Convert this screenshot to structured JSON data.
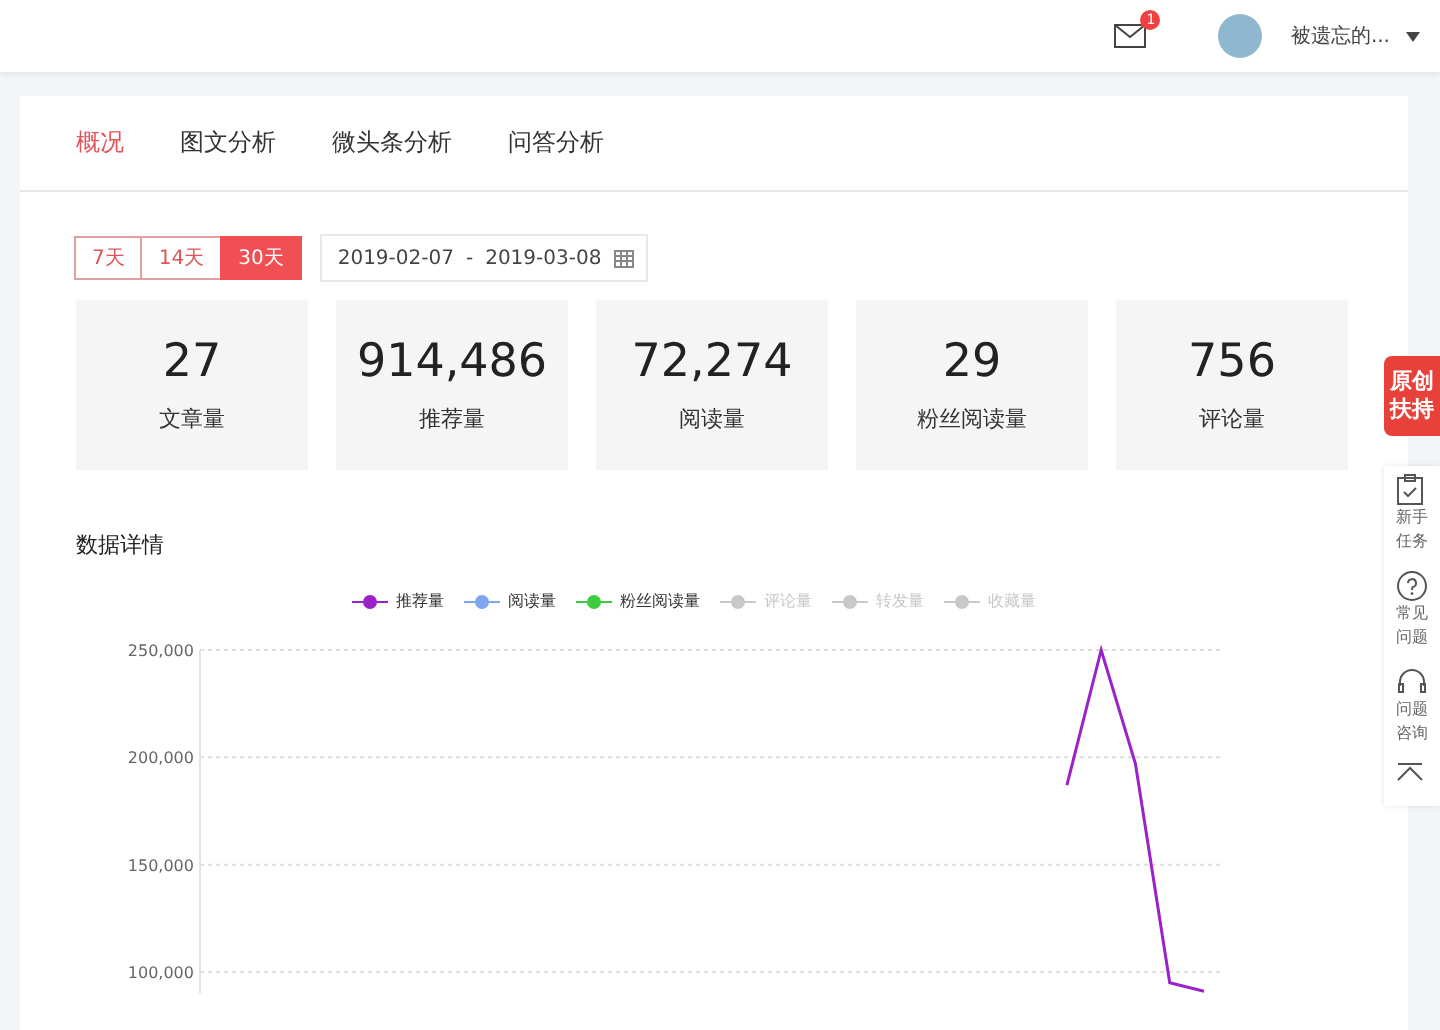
{
  "header": {
    "mail_badge": "1",
    "username": "被遗忘的..."
  },
  "tabs": [
    {
      "label": "概况",
      "selected": true
    },
    {
      "label": "图文分析",
      "selected": false
    },
    {
      "label": "微头条分析",
      "selected": false
    },
    {
      "label": "问答分析",
      "selected": false
    }
  ],
  "ranges": [
    {
      "label": "7天",
      "selected": false
    },
    {
      "label": "14天",
      "selected": false
    },
    {
      "label": "30天",
      "selected": true
    }
  ],
  "date_range": {
    "start": "2019-02-07",
    "separator": "-",
    "end": "2019-03-08"
  },
  "stats": [
    {
      "value": "27",
      "label": "文章量"
    },
    {
      "value": "914,486",
      "label": "推荐量"
    },
    {
      "value": "72,274",
      "label": "阅读量"
    },
    {
      "value": "29",
      "label": "粉丝阅读量"
    },
    {
      "value": "756",
      "label": "评论量"
    }
  ],
  "section_title": "数据详情",
  "legend": [
    {
      "on": true
    },
    {
      "label": "阅读量",
      "color": "#7ea6ee",
      "on": true
    },
    {
      "label": "粉丝阅读量",
      "color": "#3ecb3e",
      "on": true
    },
    {
      "label": "评论量",
      "on": false
    },
    {
      "label": "转发量",
      "on": false
    },
    {
      "label": "收藏量",
      "on": false
    }
  ],
  "chart_data": {
    "type": "line",
    "grid": true,
    "ylim": [
      90000,
      250000
    ],
    "yticks": [
      {
        "value": 100000,
        "label": "100,000"
      },
      {
        "value": 150000,
        "label": "150,000"
      },
      {
        "value": 200000,
        "label": "200,000"
      },
      {
        "value": 250000,
        "label": "250,000"
      }
    ],
    "series": [
      {
        "name": "推荐量",
        "color": "#9b22c9",
        "values": [
          null,
          null,
          null,
          null,
          null,
          null,
          null,
          null,
          null,
          null,
          null,
          null,
          null,
          null,
          null,
          null,
          null,
          null,
          null,
          null,
          null,
          null,
          null,
          null,
          null,
          187000,
          250000,
          197000,
          95000,
          91000
        ]
      }
    ]
  },
  "side_badge": {
    "line1": "原创",
    "line2": "扶持"
  },
  "side_tools": [
    {
      "kind": "task",
      "line1": "新手",
      "line2": "任务"
    },
    {
      "kind": "help",
      "line1": "常见",
      "line2": "问题"
    },
    {
      "kind": "support",
      "line1": "问题",
      "line2": "咨询"
    },
    {
      "kind": "top"
    }
  ]
}
